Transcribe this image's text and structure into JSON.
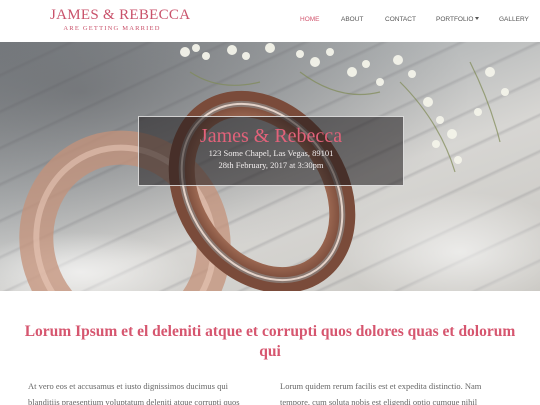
{
  "brand": {
    "title": "JAMES & REBECCA",
    "subtitle": "ARE GETTING MARRIED"
  },
  "nav": {
    "items": [
      {
        "label": "HOME",
        "active": true
      },
      {
        "label": "ABOUT",
        "active": false
      },
      {
        "label": "CONTACT",
        "active": false
      },
      {
        "label": "PORTFOLIO",
        "active": false,
        "has_dropdown": true
      },
      {
        "label": "GALLERY",
        "active": false
      }
    ]
  },
  "hero": {
    "image": "wedding-rings-with-flowers",
    "title": "James & Rebecca",
    "address": "123 Some Chapel, Las Vegas, 89101",
    "date": "28th February, 2017 at 3:30pm"
  },
  "intro": {
    "heading": "Lorum Ipsum et el deleniti atque et corrupti quos dolores quas et dolorum qui",
    "left_text": "At vero eos et accusamus et iusto dignissimos ducimus qui blanditiis praesentium voluptatum deleniti atque corrupti quos",
    "right_text": "Lorum quidem rerum facilis est et expedita distinctio. Nam tempore, cum soluta nobis est eligendi optio cumque nihil"
  },
  "colors": {
    "accent": "#d6566f",
    "nav_text": "#555555",
    "body_text": "#666666"
  }
}
